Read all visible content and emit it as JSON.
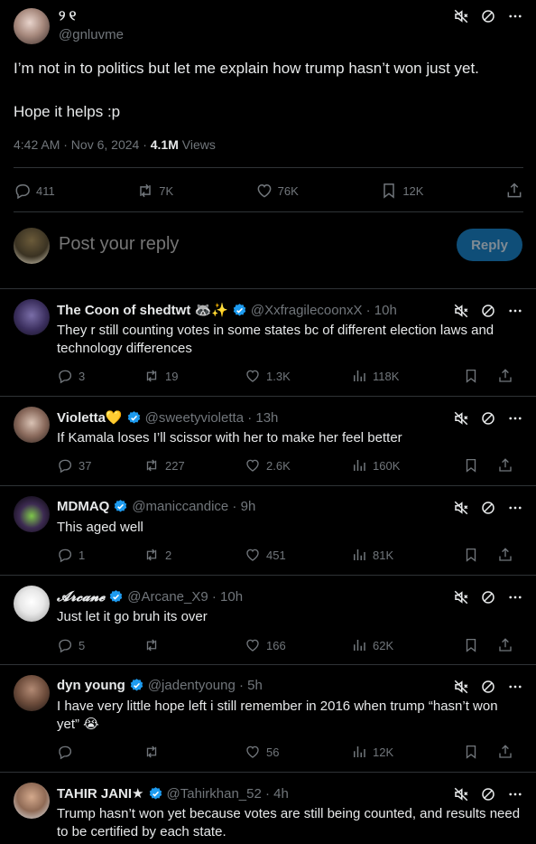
{
  "main_post": {
    "display_name": "୨ ୧",
    "handle": "@gnluvme",
    "text_line1": "I’m not in to politics but let me explain how trump hasn’t won just yet.",
    "text_line2": "Hope it helps :p",
    "time": "4:42 AM · Nov 6, 2024 · ",
    "views_count": "4.1M",
    "views_label": " Views",
    "actions": {
      "replies": "411",
      "reposts": "7K",
      "likes": "76K",
      "bookmarks": "12K"
    }
  },
  "reply_box": {
    "placeholder": "Post your reply",
    "button_label": "Reply"
  },
  "replies": [
    {
      "name": "The Coon of shedtwt 🦝✨",
      "handle": "@XxfragilecoonxX · 10h",
      "text": "They r still counting votes in some states bc of different election laws and technology differences",
      "replies": "3",
      "reposts": "19",
      "likes": "1.3K",
      "views": "118K"
    },
    {
      "name": "Violetta💛",
      "handle": "@sweetyvioletta · 13h",
      "text": "If Kamala loses I’ll scissor with her to make her feel better",
      "replies": "37",
      "reposts": "227",
      "likes": "2.6K",
      "views": "160K"
    },
    {
      "name": "MDMAQ",
      "handle": "@maniccandice · 9h",
      "text": "This aged well",
      "replies": "1",
      "reposts": "2",
      "likes": "451",
      "views": "81K"
    },
    {
      "name": "𝓐𝓻𝓬𝓪𝓷𝓮",
      "handle": "@Arcane_X9 · 10h",
      "text": "Just let it go bruh its over",
      "replies": "5",
      "reposts": "",
      "likes": "166",
      "views": "62K"
    },
    {
      "name": "dyn young",
      "handle": "@jadentyoung · 5h",
      "text": "I have very little hope left i still remember in 2016 when trump “hasn’t won yet” 😭",
      "replies": "",
      "reposts": "",
      "likes": "56",
      "views": "12K"
    },
    {
      "name": "TAHIR JANI★",
      "handle": "@Tahirkhan_52 · 4h",
      "text": "Trump hasn’t won yet because votes are still being counted, and results need to be certified by each state."
    }
  ],
  "colors": {
    "background": "#000000",
    "text": "#e7e9ea",
    "muted": "#71767b",
    "divider": "#2f3336",
    "verified": "#1d9bf0",
    "reply_button": "#0f4e78"
  },
  "icons": [
    "mute-icon",
    "block-icon",
    "more-icon",
    "reply-icon",
    "repost-icon",
    "like-icon",
    "bookmark-icon",
    "share-icon",
    "views-icon",
    "verified-badge-icon"
  ]
}
